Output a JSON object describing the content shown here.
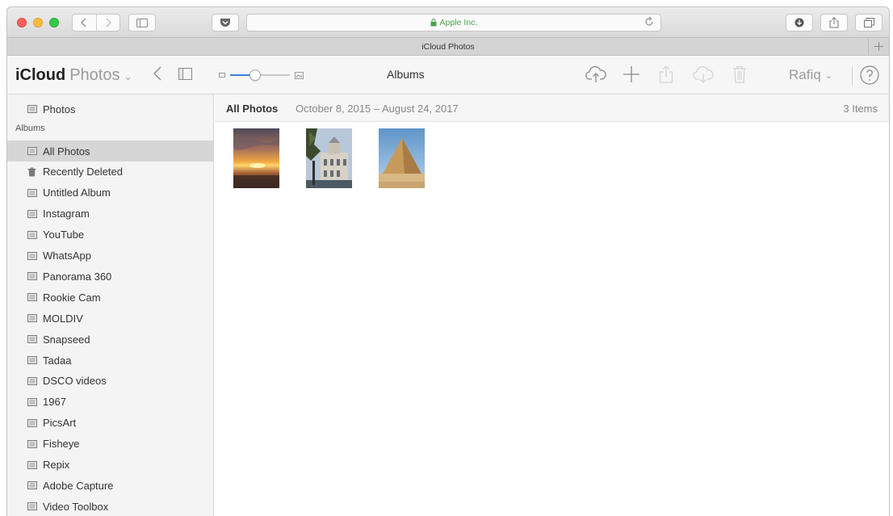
{
  "browser": {
    "url_host": "Apple Inc.",
    "tab_title": "iCloud Photos",
    "icons": [
      "chevron-left-icon",
      "chevron-right-icon",
      "sidebar-icon",
      "pocket-icon",
      "lock-icon",
      "reload-icon",
      "download-icon",
      "share-icon",
      "tabs-icon",
      "plus-icon"
    ]
  },
  "app": {
    "brand": "iCloud",
    "product": "Photos",
    "center_title": "Albums",
    "user": "Rafiq",
    "icons": [
      "upload-icon",
      "add-icon",
      "share-icon",
      "download-icon",
      "trash-icon",
      "help-icon"
    ],
    "zoom_level": 0.4
  },
  "sidebar": {
    "top_item": "Photos",
    "albums_heading": "Albums",
    "selected": "All Photos",
    "albums": [
      {
        "label": "All Photos",
        "icon": "album-icon"
      },
      {
        "label": "Recently Deleted",
        "icon": "trash-icon"
      },
      {
        "label": "Untitled Album",
        "icon": "album-icon"
      },
      {
        "label": "Instagram",
        "icon": "album-icon"
      },
      {
        "label": "YouTube",
        "icon": "album-icon"
      },
      {
        "label": "WhatsApp",
        "icon": "album-icon"
      },
      {
        "label": "Panorama 360",
        "icon": "album-icon"
      },
      {
        "label": "Rookie Cam",
        "icon": "album-icon"
      },
      {
        "label": "MOLDIV",
        "icon": "album-icon"
      },
      {
        "label": "Snapseed",
        "icon": "album-icon"
      },
      {
        "label": "Tadaa",
        "icon": "album-icon"
      },
      {
        "label": "DSCO videos",
        "icon": "album-icon"
      },
      {
        "label": "1967",
        "icon": "album-icon"
      },
      {
        "label": "PicsArt",
        "icon": "album-icon"
      },
      {
        "label": "Fisheye",
        "icon": "album-icon"
      },
      {
        "label": "Repix",
        "icon": "album-icon"
      },
      {
        "label": "Adobe Capture",
        "icon": "album-icon"
      },
      {
        "label": "Video Toolbox",
        "icon": "album-icon"
      }
    ]
  },
  "content": {
    "title": "All Photos",
    "date_range": "October 8, 2015 – August 24, 2017",
    "item_count": "3 Items",
    "photos": [
      "sunset-photo",
      "building-photo",
      "pyramid-photo"
    ]
  },
  "colors": {
    "accent": "#3b82d6",
    "lock_green": "#4aa24a",
    "selected_row": "#d6d6d6"
  }
}
